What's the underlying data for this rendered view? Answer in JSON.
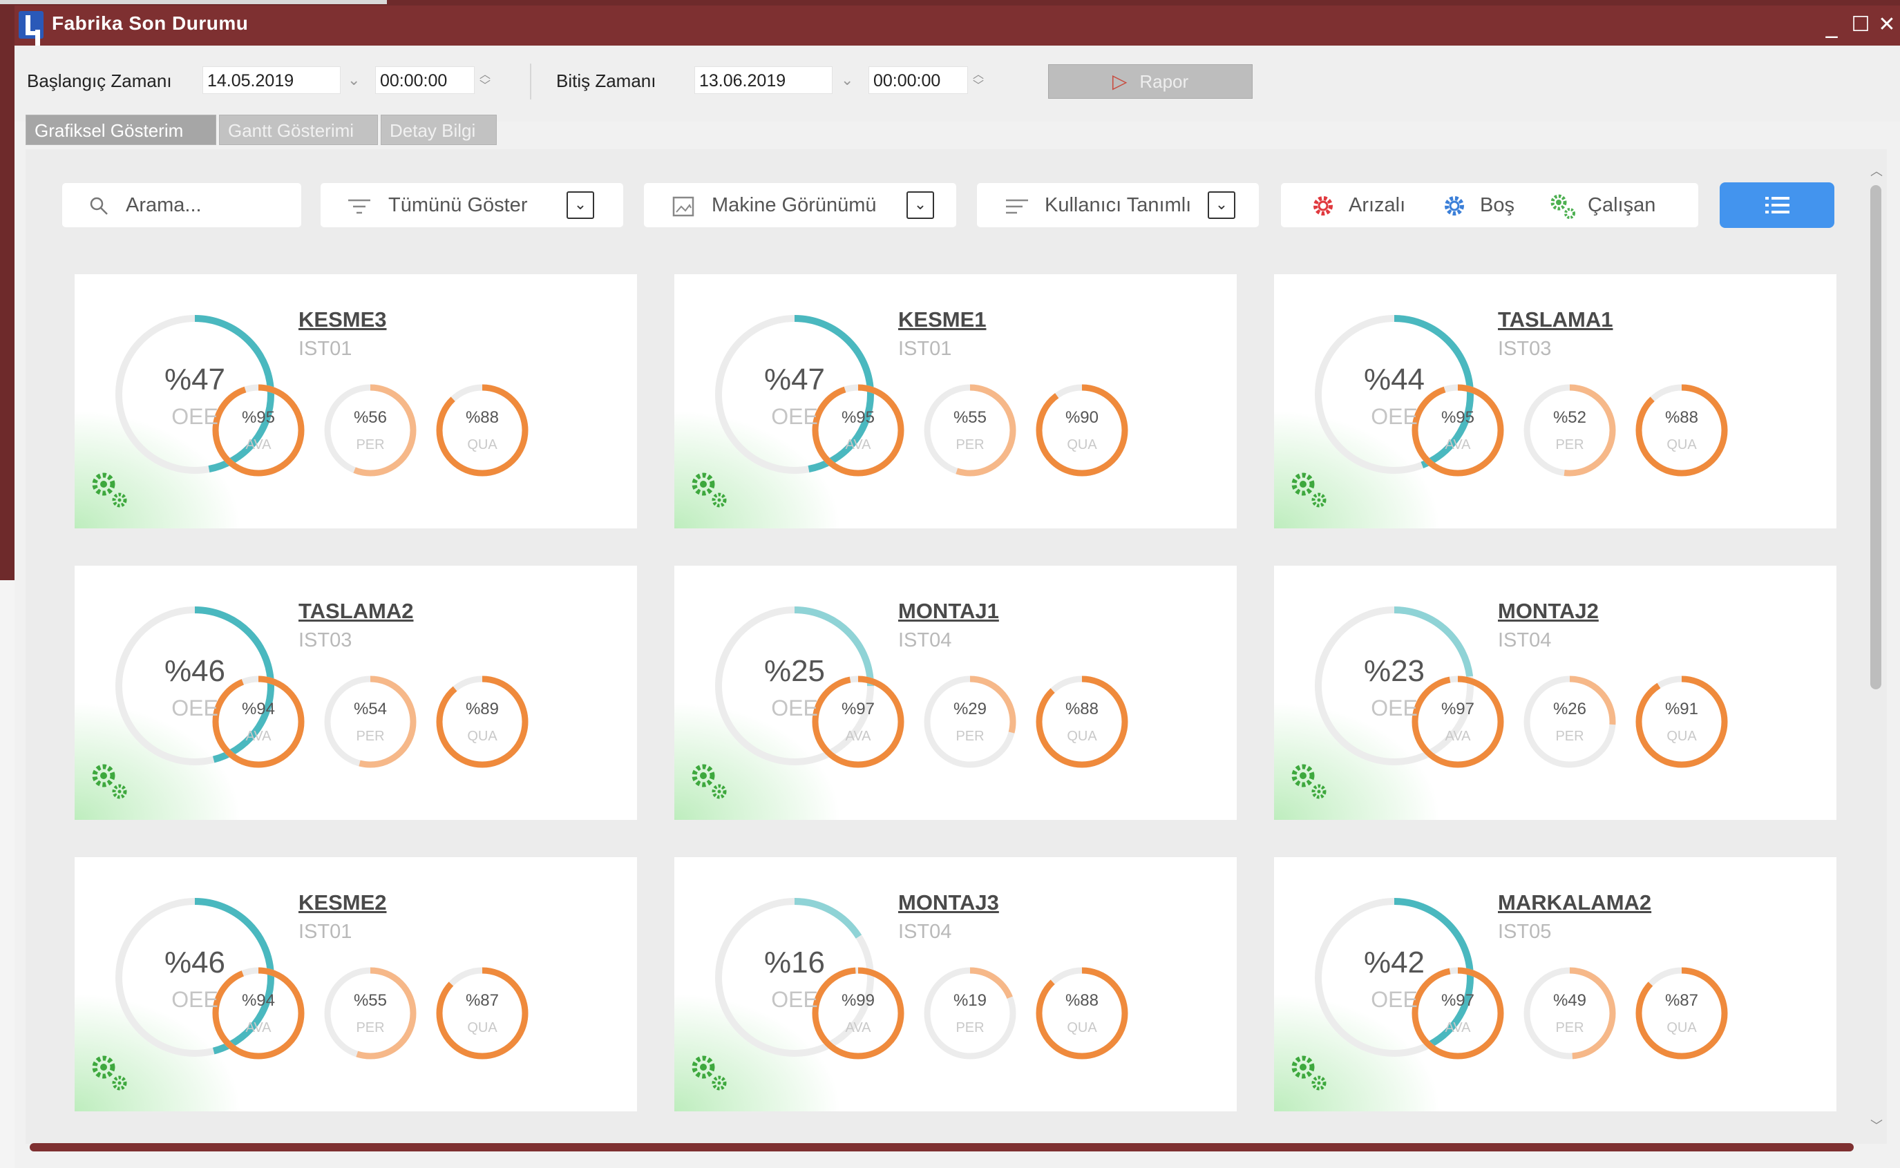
{
  "window": {
    "title": "Fabrika Son Durumu",
    "controls": {
      "minimize": "_",
      "maximize": "☐",
      "close": "✕"
    }
  },
  "toolbar": {
    "start_label": "Başlangıç Zamanı",
    "start_date": "14.05.2019",
    "start_time": "00:00:00",
    "end_label": "Bitiş Zamanı",
    "end_date": "13.06.2019",
    "end_time": "00:00:00",
    "report_button": "Rapor"
  },
  "tabs": [
    {
      "label": "Grafiksel Gösterim",
      "active": true
    },
    {
      "label": "Gantt Gösterimi",
      "active": false
    },
    {
      "label": "Detay Bilgi",
      "active": false
    }
  ],
  "filters": {
    "search_placeholder": "Arama...",
    "show_filter": "Tümünü Göster",
    "view_filter": "Makine Görünümü",
    "sort_filter": "Kullanıcı Tanımlı"
  },
  "legend": [
    {
      "label": "Arızalı",
      "color": "#e0393e",
      "icon": "gear-red-icon"
    },
    {
      "label": "Boş",
      "color": "#3b7fd8",
      "icon": "gear-blue-icon"
    },
    {
      "label": "Çalışan",
      "color": "#4caf50",
      "icon": "gear-green-icon"
    }
  ],
  "colors": {
    "oee_ring": "#4ab8bf",
    "oee_ring_light": "#8fd3d6",
    "metric_ring": "#ef8a3c",
    "metric_ring_light": "#f6b889",
    "track": "#ececec",
    "running_green": "#3ea83e"
  },
  "metric_labels": {
    "ava": "AVA",
    "per": "PER",
    "qua": "QUA",
    "oee": "OEE"
  },
  "machines": [
    {
      "name": "KESME3",
      "station": "IST01",
      "oee": 47,
      "oee_text": "%47",
      "ava": 95,
      "ava_text": "%95",
      "per": 56,
      "per_text": "%56",
      "qua": 88,
      "qua_text": "%88",
      "status": "running"
    },
    {
      "name": "KESME1",
      "station": "IST01",
      "oee": 47,
      "oee_text": "%47",
      "ava": 95,
      "ava_text": "%95",
      "per": 55,
      "per_text": "%55",
      "qua": 90,
      "qua_text": "%90",
      "status": "running"
    },
    {
      "name": "TASLAMA1",
      "station": "IST03",
      "oee": 44,
      "oee_text": "%44",
      "ava": 95,
      "ava_text": "%95",
      "per": 52,
      "per_text": "%52",
      "qua": 88,
      "qua_text": "%88",
      "status": "running"
    },
    {
      "name": "TASLAMA2",
      "station": "IST03",
      "oee": 46,
      "oee_text": "%46",
      "ava": 94,
      "ava_text": "%94",
      "per": 54,
      "per_text": "%54",
      "qua": 89,
      "qua_text": "%89",
      "status": "running"
    },
    {
      "name": "MONTAJ1",
      "station": "IST04",
      "oee": 25,
      "oee_text": "%25",
      "ava": 97,
      "ava_text": "%97",
      "per": 29,
      "per_text": "%29",
      "qua": 88,
      "qua_text": "%88",
      "status": "running"
    },
    {
      "name": "MONTAJ2",
      "station": "IST04",
      "oee": 23,
      "oee_text": "%23",
      "ava": 97,
      "ava_text": "%97",
      "per": 26,
      "per_text": "%26",
      "qua": 91,
      "qua_text": "%91",
      "status": "running"
    },
    {
      "name": "KESME2",
      "station": "IST01",
      "oee": 46,
      "oee_text": "%46",
      "ava": 94,
      "ava_text": "%94",
      "per": 55,
      "per_text": "%55",
      "qua": 87,
      "qua_text": "%87",
      "status": "running"
    },
    {
      "name": "MONTAJ3",
      "station": "IST04",
      "oee": 16,
      "oee_text": "%16",
      "ava": 99,
      "ava_text": "%99",
      "per": 19,
      "per_text": "%19",
      "qua": 88,
      "qua_text": "%88",
      "status": "running"
    },
    {
      "name": "MARKALAMA2",
      "station": "IST05",
      "oee": 42,
      "oee_text": "%42",
      "ava": 97,
      "ava_text": "%97",
      "per": 49,
      "per_text": "%49",
      "qua": 87,
      "qua_text": "%87",
      "status": "running"
    }
  ]
}
